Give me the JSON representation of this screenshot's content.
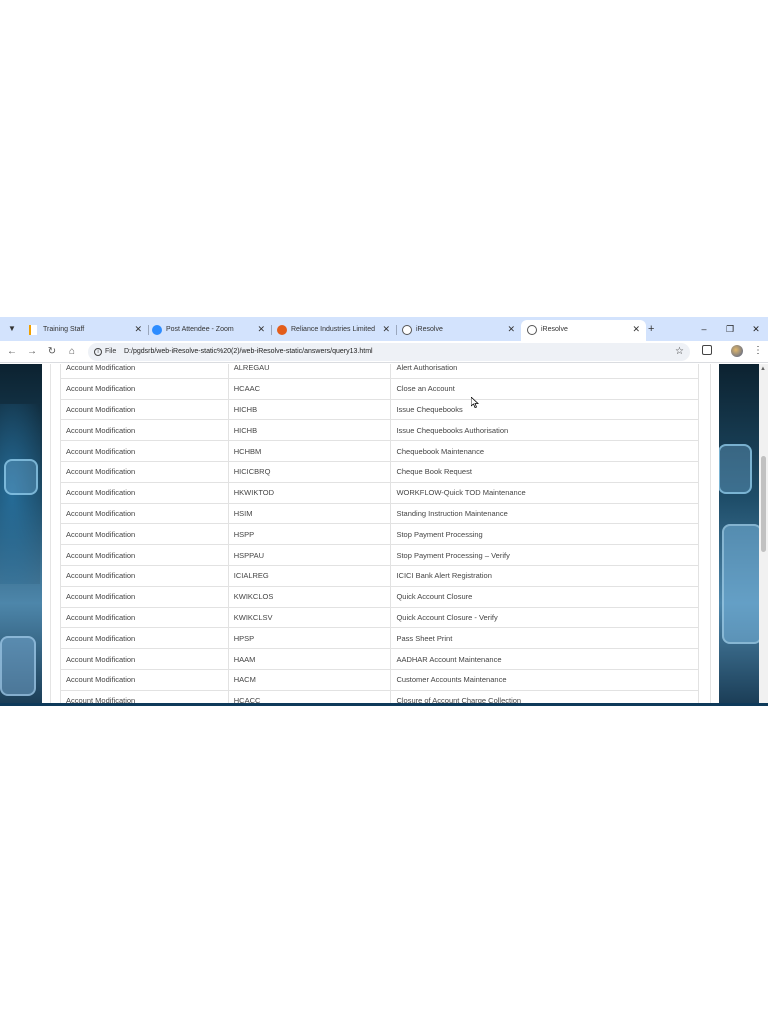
{
  "browser": {
    "tabs": [
      {
        "title": "Training Staff",
        "active": false
      },
      {
        "title": "Post Attendee - Zoom",
        "active": false
      },
      {
        "title": "Reliance Industries Limited",
        "active": false
      },
      {
        "title": "iResolve",
        "active": false
      },
      {
        "title": "iResolve",
        "active": true
      }
    ],
    "new_tab": "+",
    "window_controls": {
      "minimize": "–",
      "restore": "❐",
      "close": "✕"
    },
    "address_bar": {
      "file_label": "File",
      "url": "D:/pgdsrb/web-iResolve-static%20(2)/web-iResolve-static/answers/query13.html"
    },
    "icons": {
      "back": "back-arrow-icon",
      "forward": "forward-arrow-icon",
      "reload": "reload-icon",
      "home": "home-icon",
      "bookmark": "star-icon",
      "extensions": "extensions-icon",
      "profile": "profile-avatar",
      "menu": "kebab-menu-icon"
    }
  },
  "table": {
    "rows": [
      [
        "Account Modification",
        "ALREGAU",
        "Alert Authorisation"
      ],
      [
        "Account Modification",
        "HCAAC",
        "Close an Account"
      ],
      [
        "Account Modification",
        "HICHB",
        "Issue Chequebooks"
      ],
      [
        "Account Modification",
        "HICHB",
        "Issue Chequebooks Authorisation"
      ],
      [
        "Account Modification",
        "HCHBM",
        "Chequebook Maintenance"
      ],
      [
        "Account Modification",
        "HICICBRQ",
        "Cheque Book Request"
      ],
      [
        "Account Modification",
        "HKWIKTOD",
        "WORKFLOW-Quick TOD Maintenance"
      ],
      [
        "Account Modification",
        "HSIM",
        "Standing Instruction Maintenance"
      ],
      [
        "Account Modification",
        "HSPP",
        "Stop Payment Processing"
      ],
      [
        "Account Modification",
        "HSPPAU",
        "Stop Payment Processing – Verify"
      ],
      [
        "Account Modification",
        "ICIALREG",
        "ICICI Bank Alert Registration"
      ],
      [
        "Account Modification",
        "KWIKCLOS",
        "Quick Account Closure"
      ],
      [
        "Account Modification",
        "KWIKCLSV",
        "Quick Account Closure - Verify"
      ],
      [
        "Account Modification",
        "HPSP",
        "Pass Sheet Print"
      ],
      [
        "Account Modification",
        "HAAM",
        "AADHAR Account Maintenance"
      ],
      [
        "Account Modification",
        "HACM",
        "Customer Accounts Maintenance"
      ],
      [
        "Account Modification",
        "HCACC",
        "Closure of Account Charge Collection"
      ]
    ]
  }
}
